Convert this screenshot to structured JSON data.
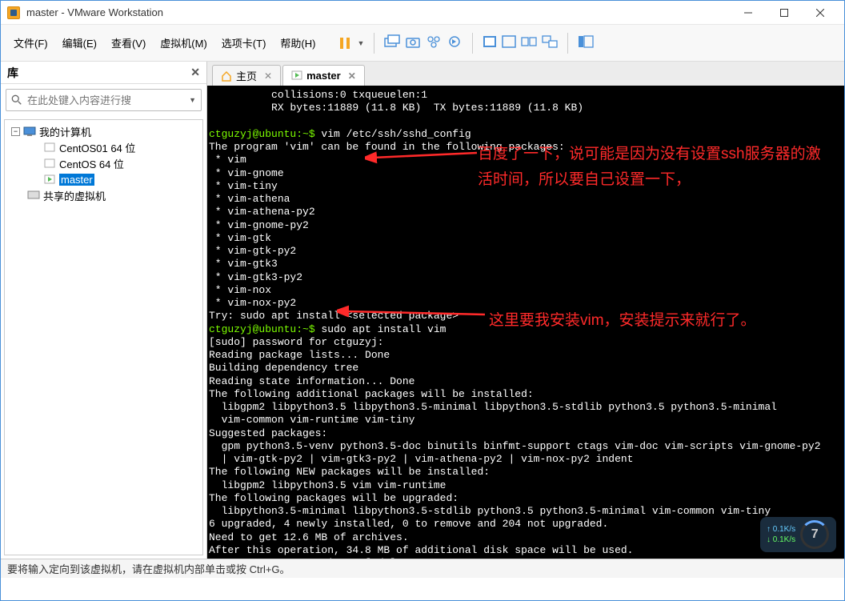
{
  "window": {
    "title": "master - VMware Workstation"
  },
  "menu": {
    "file": "文件(F)",
    "edit": "编辑(E)",
    "view": "查看(V)",
    "vm": "虚拟机(M)",
    "tabs": "选项卡(T)",
    "help": "帮助(H)"
  },
  "sidebar": {
    "header": "库",
    "search_placeholder": "在此处键入内容进行搜",
    "root": "我的计算机",
    "items": [
      "CentOS01 64 位",
      "CentOS 64 位",
      "master"
    ],
    "shared": "共享的虚拟机"
  },
  "tabs": {
    "home": "主页",
    "vm": "master"
  },
  "console_lines": [
    "          collisions:0 txqueuelen:1",
    "          RX bytes:11889 (11.8 KB)  TX bytes:11889 (11.8 KB)",
    "",
    "ctguzyj@ubuntu:~$ vim /etc/ssh/sshd_config",
    "The program 'vim' can be found in the following packages:",
    " * vim",
    " * vim-gnome",
    " * vim-tiny",
    " * vim-athena",
    " * vim-athena-py2",
    " * vim-gnome-py2",
    " * vim-gtk",
    " * vim-gtk-py2",
    " * vim-gtk3",
    " * vim-gtk3-py2",
    " * vim-nox",
    " * vim-nox-py2",
    "Try: sudo apt install <selected package>",
    "ctguzyj@ubuntu:~$ sudo apt install vim",
    "[sudo] password for ctguzyj:",
    "Reading package lists... Done",
    "Building dependency tree",
    "Reading state information... Done",
    "The following additional packages will be installed:",
    "  libgpm2 libpython3.5 libpython3.5-minimal libpython3.5-stdlib python3.5 python3.5-minimal",
    "  vim-common vim-runtime vim-tiny",
    "Suggested packages:",
    "  gpm python3.5-venv python3.5-doc binutils binfmt-support ctags vim-doc vim-scripts vim-gnome-py2",
    "  | vim-gtk-py2 | vim-gtk3-py2 | vim-athena-py2 | vim-nox-py2 indent",
    "The following NEW packages will be installed:",
    "  libgpm2 libpython3.5 vim vim-runtime",
    "The following packages will be upgraded:",
    "  libpython3.5-minimal libpython3.5-stdlib python3.5 python3.5-minimal vim-common vim-tiny",
    "6 upgraded, 4 newly installed, 0 to remove and 204 not upgraded.",
    "Need to get 12.6 MB of archives.",
    "After this operation, 34.8 MB of additional disk space will be used.",
    "Do you want to continue? [Y/n]"
  ],
  "annotations": {
    "top": "百度了一下，说可能是因为没有设置ssh服务器的激活时间，所以要自己设置一下，",
    "bottom": "这里要我安装vim，安装提示来就行了。"
  },
  "statusbar": "要将输入定向到该虚拟机，请在虚拟机内部单击或按 Ctrl+G。",
  "net": {
    "up": "0.1K/s",
    "down": "0.1K/s",
    "num": "7"
  }
}
